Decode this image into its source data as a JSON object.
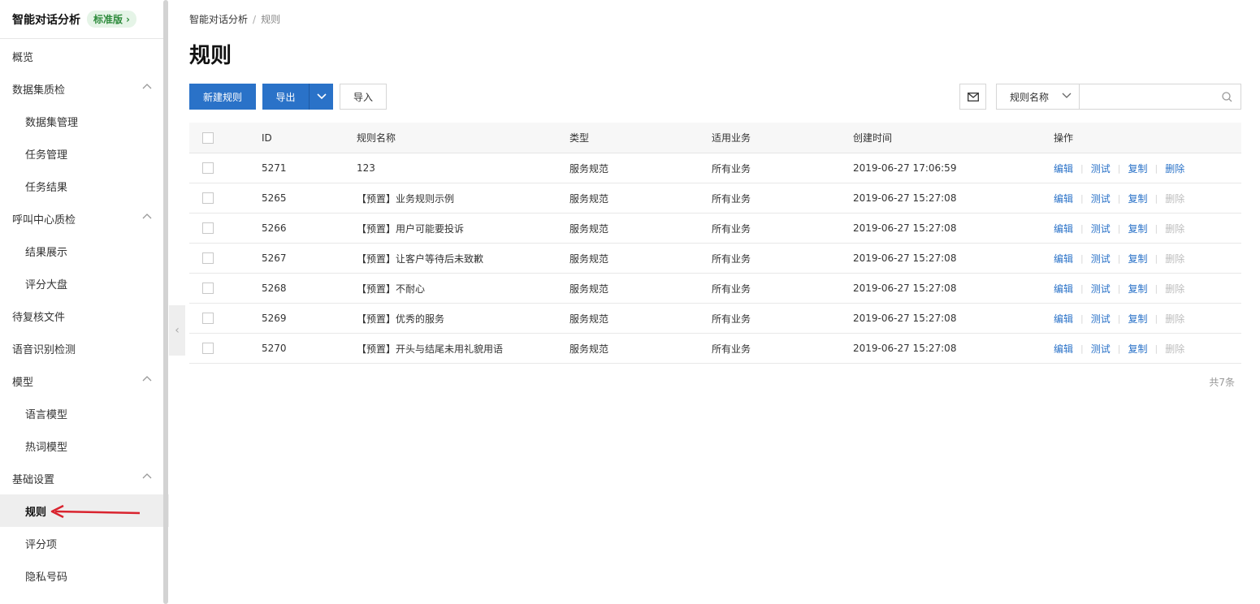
{
  "brand": {
    "title": "智能对话分析",
    "badge": "标准版"
  },
  "menu": [
    {
      "label": "概览",
      "level": 1
    },
    {
      "label": "数据集质检",
      "level": 1,
      "expanded": true
    },
    {
      "label": "数据集管理",
      "level": 2
    },
    {
      "label": "任务管理",
      "level": 2
    },
    {
      "label": "任务结果",
      "level": 2
    },
    {
      "label": "呼叫中心质检",
      "level": 1,
      "expanded": true
    },
    {
      "label": "结果展示",
      "level": 2
    },
    {
      "label": "评分大盘",
      "level": 2
    },
    {
      "label": "待复核文件",
      "level": 1
    },
    {
      "label": "语音识别检测",
      "level": 1
    },
    {
      "label": "模型",
      "level": 1,
      "expanded": true
    },
    {
      "label": "语言模型",
      "level": 2
    },
    {
      "label": "热词模型",
      "level": 2
    },
    {
      "label": "基础设置",
      "level": 1,
      "expanded": true
    },
    {
      "label": "规则",
      "level": 2,
      "active": true
    },
    {
      "label": "评分项",
      "level": 2
    },
    {
      "label": "隐私号码",
      "level": 2
    }
  ],
  "breadcrumb": {
    "root": "智能对话分析",
    "current": "规则"
  },
  "page_title": "规则",
  "toolbar": {
    "new_label": "新建规则",
    "export_label": "导出",
    "import_label": "导入",
    "filter_select": "规则名称",
    "search_placeholder": ""
  },
  "table": {
    "columns": {
      "id": "ID",
      "name": "规则名称",
      "type": "类型",
      "biz": "适用业务",
      "time": "创建时间",
      "ops": "操作"
    },
    "ops_labels": {
      "edit": "编辑",
      "test": "测试",
      "copy": "复制",
      "delete": "删除"
    },
    "rows": [
      {
        "id": "5271",
        "name": "123",
        "type": "服务规范",
        "biz": "所有业务",
        "time": "2019-06-27 17:06:59",
        "deletable": true
      },
      {
        "id": "5265",
        "name": "【预置】业务规则示例",
        "type": "服务规范",
        "biz": "所有业务",
        "time": "2019-06-27 15:27:08",
        "deletable": false
      },
      {
        "id": "5266",
        "name": "【预置】用户可能要投诉",
        "type": "服务规范",
        "biz": "所有业务",
        "time": "2019-06-27 15:27:08",
        "deletable": false
      },
      {
        "id": "5267",
        "name": "【预置】让客户等待后未致歉",
        "type": "服务规范",
        "biz": "所有业务",
        "time": "2019-06-27 15:27:08",
        "deletable": false
      },
      {
        "id": "5268",
        "name": "【预置】不耐心",
        "type": "服务规范",
        "biz": "所有业务",
        "time": "2019-06-27 15:27:08",
        "deletable": false
      },
      {
        "id": "5269",
        "name": "【预置】优秀的服务",
        "type": "服务规范",
        "biz": "所有业务",
        "time": "2019-06-27 15:27:08",
        "deletable": false
      },
      {
        "id": "5270",
        "name": "【预置】开头与结尾未用礼貌用语",
        "type": "服务规范",
        "biz": "所有业务",
        "time": "2019-06-27 15:27:08",
        "deletable": false
      }
    ],
    "total": "共7条"
  },
  "colors": {
    "primary": "#2a72c8",
    "annotation_arrow": "#d9232e",
    "badge_bg": "#e5f4e7",
    "badge_fg": "#2e8b3c"
  }
}
